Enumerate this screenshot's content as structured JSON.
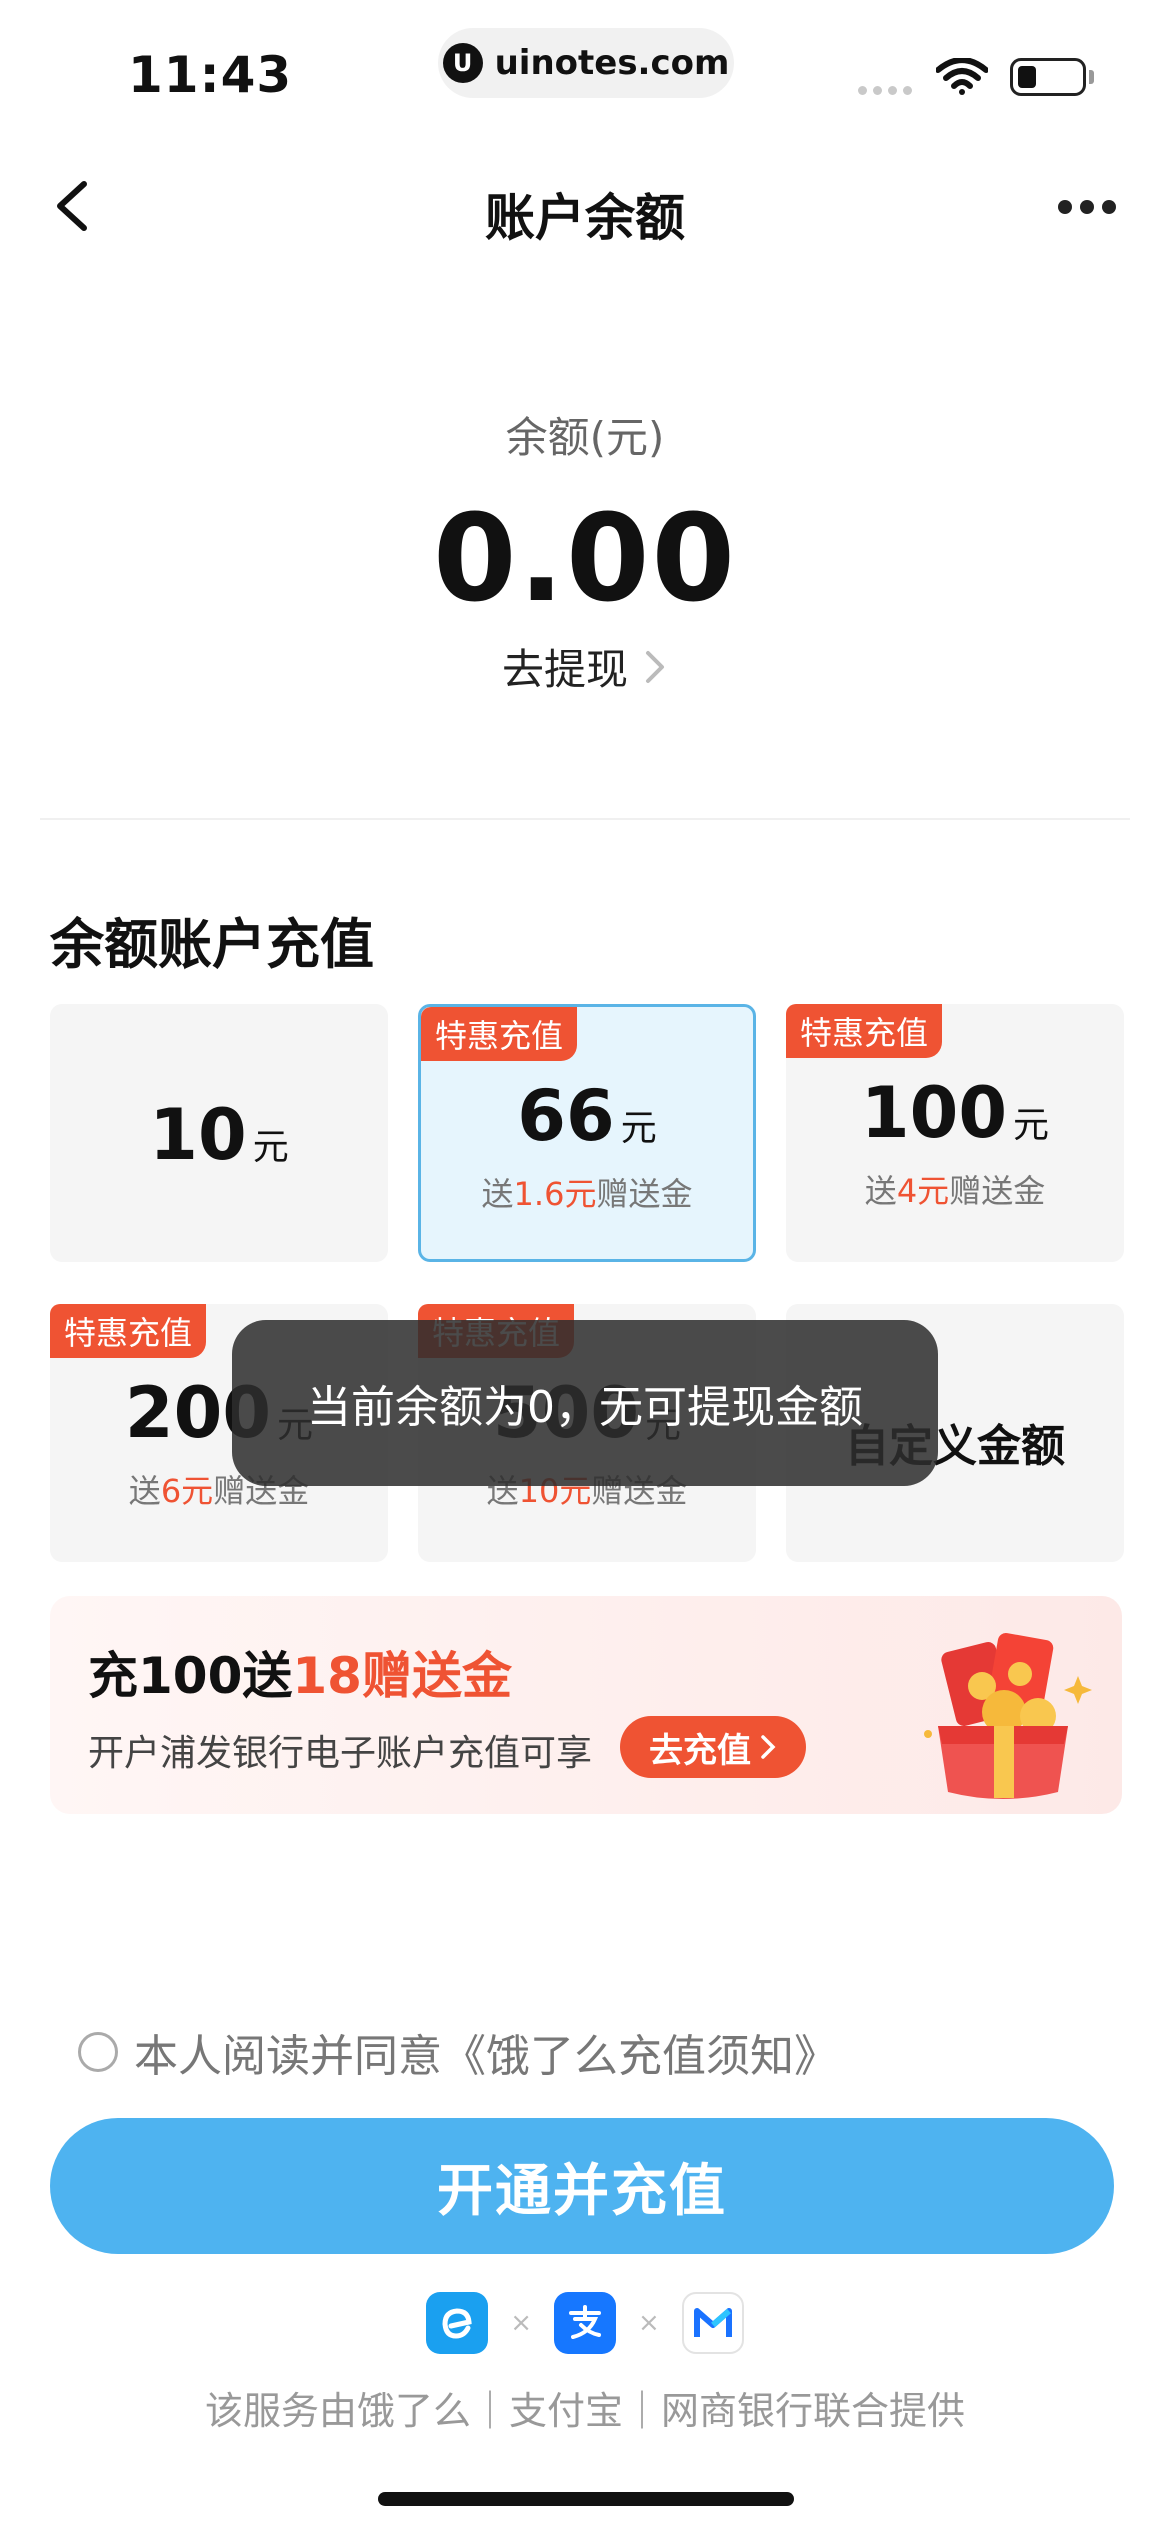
{
  "status_bar": {
    "time": "11:43",
    "url": "uinotes.com"
  },
  "nav": {
    "title": "账户余额"
  },
  "balance": {
    "label": "余额(元)",
    "value": "0.00",
    "withdraw_label": "去提现"
  },
  "recharge": {
    "section_title": "余额账户充值",
    "tag": "特惠充值",
    "cards": [
      {
        "amount": "10",
        "unit": "元"
      },
      {
        "amount": "66",
        "unit": "元",
        "gift_prefix": "送",
        "gift_amount": "1.6元",
        "gift_suffix": "赠送金"
      },
      {
        "amount": "100",
        "unit": "元",
        "gift_prefix": "送",
        "gift_amount": "4元",
        "gift_suffix": "赠送金"
      },
      {
        "amount": "200",
        "unit": "元",
        "gift_prefix": "送",
        "gift_amount": "6元",
        "gift_suffix": "赠送金"
      },
      {
        "amount": "500",
        "unit": "元",
        "gift_prefix": "送",
        "gift_amount": "10元",
        "gift_suffix": "赠送金"
      },
      {
        "custom_label": "自定义金额"
      }
    ]
  },
  "toast": {
    "message": "当前余额为0，无可提现金额"
  },
  "promo": {
    "title_prefix": "充100送",
    "title_highlight": "18赠送金",
    "subtitle": "开户浦发银行电子账户充值可享",
    "button_label": "去充值"
  },
  "agreement": {
    "text": "本人阅读并同意《饿了么充值须知》"
  },
  "cta": {
    "label": "开通并充值"
  },
  "footer": {
    "times": "×",
    "text": "该服务由饿了么｜支付宝｜网商银行联合提供"
  },
  "colors": {
    "accent": "#4eb3f0",
    "highlight": "#ef5333",
    "selected_bg": "#e6f5fd"
  }
}
